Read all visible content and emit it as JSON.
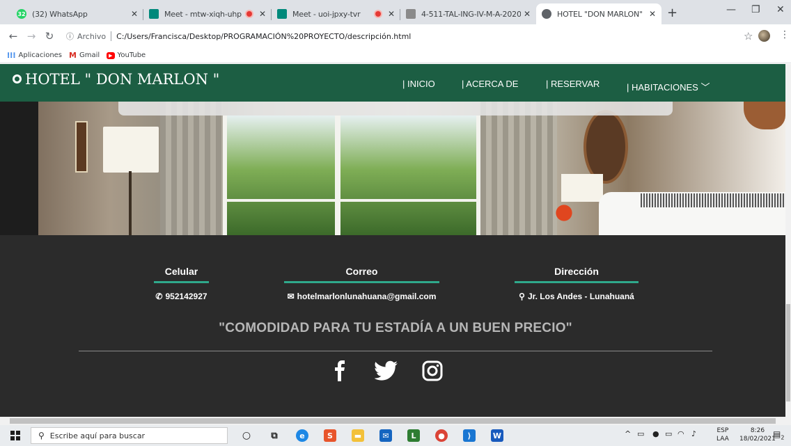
{
  "browser": {
    "tabs": [
      {
        "title": "(32) WhatsApp",
        "icon": "whatsapp-icon",
        "badge": "32"
      },
      {
        "title": "Meet - mtw-xiqh-uhp",
        "icon": "meet-icon"
      },
      {
        "title": "Meet - uoi-jpxy-tvr",
        "icon": "meet-icon"
      },
      {
        "title": "4-511-TAL-ING-IV-M-A-2020-",
        "icon": "classroom-icon"
      },
      {
        "title": "HOTEL \"DON MARLON\"",
        "icon": "globe-icon"
      }
    ],
    "address": {
      "prefix": "Archivo",
      "url": "C:/Users/Francisca/Desktop/PROGRAMACIÓN%20PROYECTO/descripción.html"
    },
    "bookmarks": [
      {
        "label": "Aplicaciones",
        "icon": "apps-icon"
      },
      {
        "label": "Gmail",
        "icon": "gmail-icon"
      },
      {
        "label": "YouTube",
        "icon": "youtube-icon"
      }
    ]
  },
  "site": {
    "brand": "HOTEL \" DON MARLON \"",
    "nav": [
      "| INICIO",
      "| ACERCA DE",
      "| RESERVAR",
      "| HABITACIONES"
    ],
    "footer": {
      "columns": [
        {
          "heading": "Celular",
          "value": "952142927",
          "icon": "phone-icon"
        },
        {
          "heading": "Correo",
          "value": "hotelmarlonlunahuana@gmail.com",
          "icon": "envelope-icon"
        },
        {
          "heading": "Dirección",
          "value": "Jr. Los Andes - Lunahuaná",
          "icon": "map-pin-icon"
        }
      ],
      "slogan": "\"COMODIDAD PARA TU ESTADÍA A UN BUEN PRECIO\"",
      "social": [
        "facebook-icon",
        "twitter-icon",
        "instagram-icon"
      ]
    },
    "colors": {
      "nav_bg": "#1c5e43",
      "footer_bg": "#2b2b2b",
      "accent": "#2fa98c"
    }
  },
  "taskbar": {
    "search_placeholder": "Escribe aquí para buscar",
    "lang": [
      "ESP",
      "LAA"
    ],
    "time": "8:26",
    "date": "18/02/2021",
    "notifications": "2"
  }
}
